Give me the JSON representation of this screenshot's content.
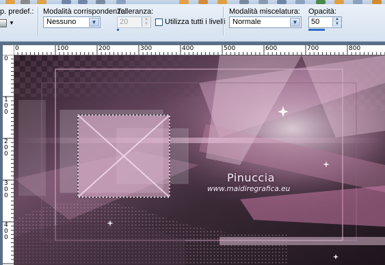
{
  "options": {
    "preset_label": "p. predef.:",
    "mode_label": "Modalità corrispondenza:",
    "mode_value": "Nessuno",
    "tolerance_label": "Tolleranza:",
    "tolerance_value": "20",
    "all_layers_label": "Utilizza tutti i livelli",
    "blend_label": "Modalità miscelatura:",
    "blend_value": "Normale",
    "opacity_label": "Opacità:",
    "opacity_value": "50"
  },
  "ruler_h": [
    "0",
    "100",
    "200",
    "300",
    "400",
    "500",
    "600",
    "700",
    "800"
  ],
  "ruler_v": [
    "0",
    "1\n0\n0",
    "2\n0\n0",
    "3\n0\n0",
    "4\n0\n0"
  ],
  "canvas": {
    "watermark_title": "Pinuccia",
    "watermark_url": "www.maidiregrafica.eu"
  },
  "colors": {
    "accent": "#2e6bc6",
    "image_pink": "#d4a0c0",
    "image_dark": "#2a1a26"
  }
}
